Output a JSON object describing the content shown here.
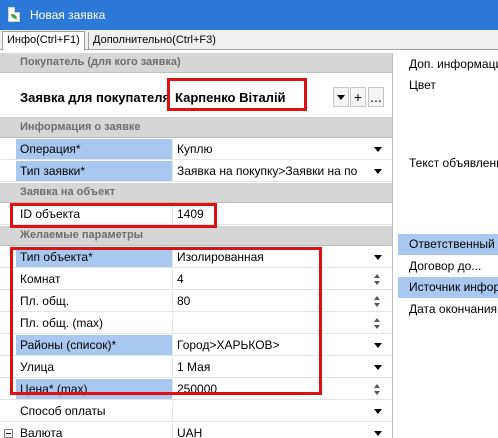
{
  "window": {
    "title": "Новая заявка"
  },
  "tabs": [
    {
      "label": "Инфо(Ctrl+F1)"
    },
    {
      "label": "Дополнительно(Ctrl+F3)"
    }
  ],
  "sections": {
    "buyer": "Покупатель (для кого заявка)",
    "order_info": "Информация о заявке",
    "object_request": "Заявка на объект",
    "desired": "Желаемые параметры"
  },
  "buyer": {
    "label": "Заявка для покупателя",
    "value": "Карпенко Віталій",
    "add_label": "+",
    "more_label": "..."
  },
  "order_info": {
    "operation_label": "Операция*",
    "operation_value": "Куплю",
    "type_label": "Тип заявки*",
    "type_value": "Заявка на покупку>Заявки на по"
  },
  "object_request": {
    "id_label": "ID объекта",
    "id_value": "1409"
  },
  "desired": {
    "object_type_label": "Тип объекта*",
    "object_type_value": "Изолированная",
    "rooms_label": "Комнат",
    "rooms_value": "4",
    "area_label": "Пл. общ.",
    "area_value": "80",
    "area_max_label": "Пл. общ. (max)",
    "area_max_value": "",
    "districts_label": "Районы (список)*",
    "districts_value": "Город>ХАРЬКОВ>",
    "street_label": "Улица",
    "street_value": "1 Мая",
    "price_label": "Цена* (max)",
    "price_value": "250000",
    "payment_label": "Способ оплаты",
    "payment_value": "",
    "currency_label": "Валюта",
    "currency_value": "UAH"
  },
  "right_panel": {
    "extra_info": "Доп. информация",
    "color": "Цвет",
    "ad_text": "Текст объявления",
    "responsible": "Ответственный",
    "contract": "Договор до...",
    "info_source": "Источник информации",
    "end_date": "Дата окончания"
  }
}
